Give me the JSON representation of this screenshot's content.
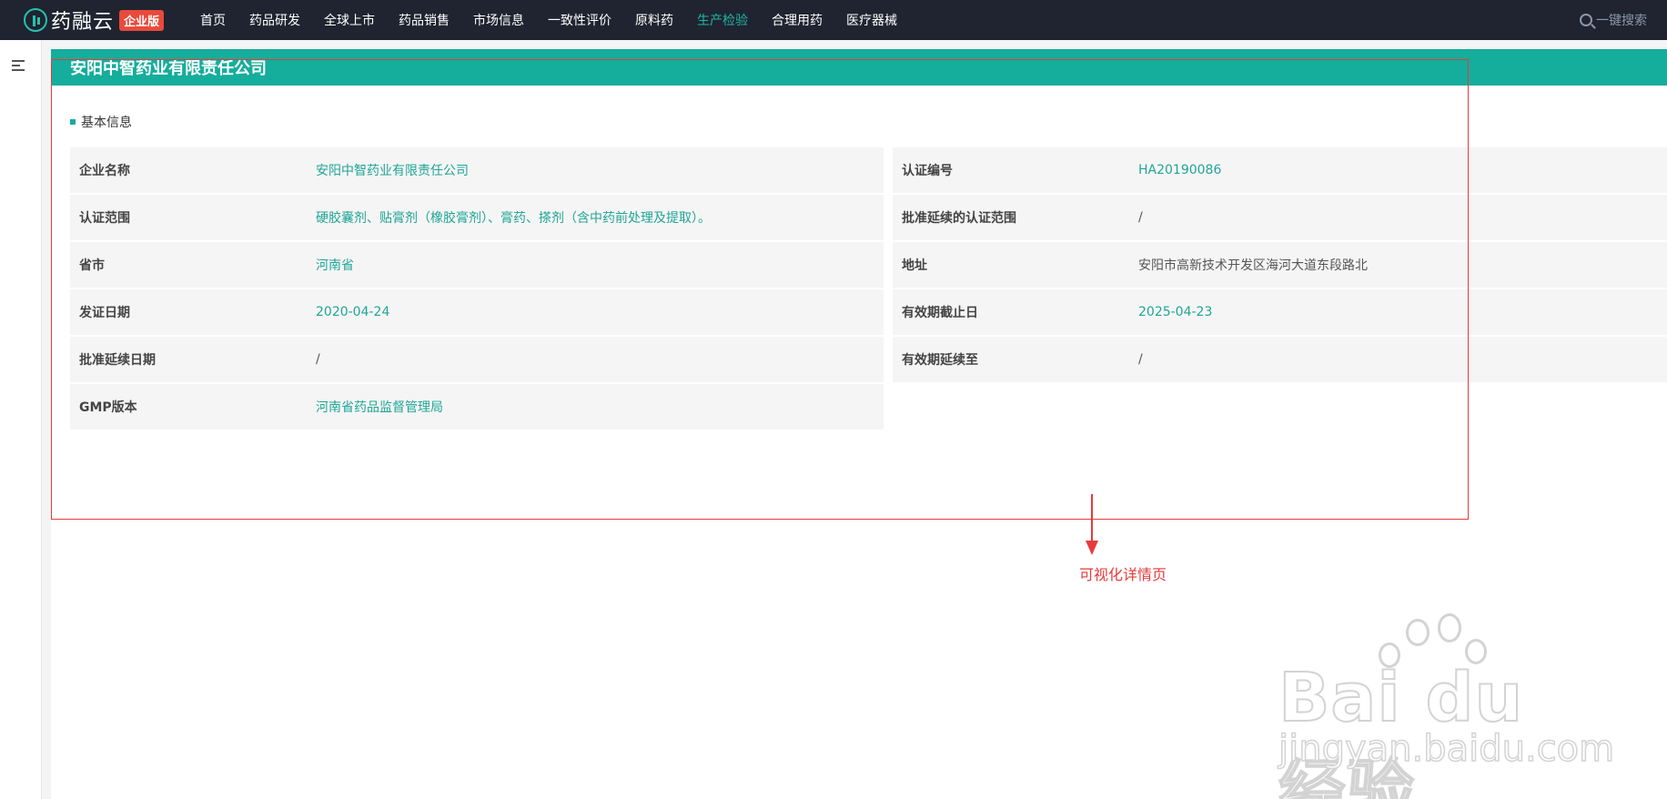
{
  "app": {
    "logo_text": "药融云",
    "logo_badge": "企业版"
  },
  "nav": {
    "items": [
      {
        "label": "首页",
        "active": false
      },
      {
        "label": "药品研发",
        "active": false
      },
      {
        "label": "全球上市",
        "active": false
      },
      {
        "label": "药品销售",
        "active": false
      },
      {
        "label": "市场信息",
        "active": false
      },
      {
        "label": "一致性评价",
        "active": false
      },
      {
        "label": "原料药",
        "active": false
      },
      {
        "label": "生产检验",
        "active": true
      },
      {
        "label": "合理用药",
        "active": false
      },
      {
        "label": "医疗器械",
        "active": false
      }
    ],
    "search_label": "一键搜索"
  },
  "page": {
    "title": "安阳中智药业有限责任公司",
    "section_title": "基本信息"
  },
  "info": {
    "rows": [
      {
        "l1": "企业名称",
        "v1": "安阳中智药业有限责任公司",
        "l2": "认证编号",
        "v2": "HA20190086"
      },
      {
        "l1": "认证范围",
        "v1": "硬胶囊剂、贴膏剂（橡胶膏剂）、膏药、搽剂（含中药前处理及提取）。",
        "l2": "批准延续的认证范围",
        "v2": "/"
      },
      {
        "l1": "省市",
        "v1": "河南省",
        "l2": "地址",
        "v2": "安阳市高新技术开发区海河大道东段路北"
      },
      {
        "l1": "发证日期",
        "v1": "2020-04-24",
        "l2": "有效期截止日",
        "v2": "2025-04-23"
      },
      {
        "l1": "批准延续日期",
        "v1": "/",
        "l2": "有效期延续至",
        "v2": "/"
      },
      {
        "l1": "GMP版本",
        "v1": "河南省药品监督管理局"
      }
    ]
  },
  "annotation": {
    "text": "可视化详情页"
  },
  "watermark": {
    "main": "Bai du 经验",
    "url": "jingyan.baidu.com"
  },
  "colors": {
    "accent": "#15ad9c",
    "topbar": "#1f2430",
    "annotation": "#e63b3b"
  }
}
